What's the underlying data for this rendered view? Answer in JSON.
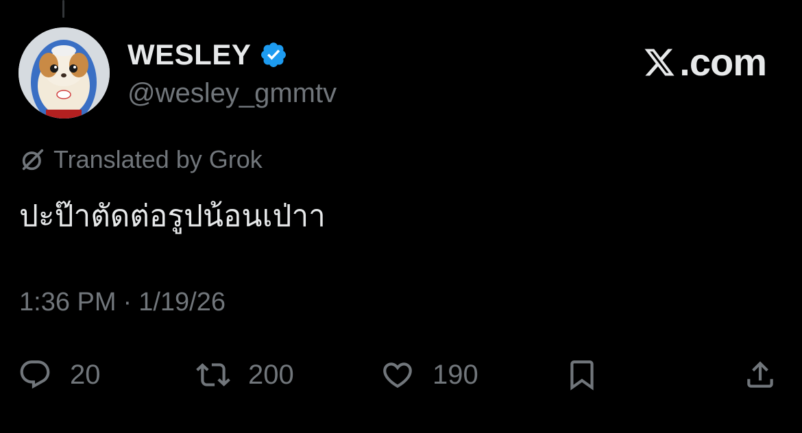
{
  "user": {
    "display_name": "WESLEY",
    "handle": "@wesley_gmmtv",
    "verified_icon": "verified-badge-icon"
  },
  "brand": {
    "text": ".com",
    "logo_icon": "x-logo-icon"
  },
  "tweet": {
    "translation_label": "Translated by Grok",
    "text": "ปะป๊าตัดต่อรูปน้อนเป่าา",
    "time": "1:36 PM",
    "separator": "·",
    "date": "1/19/26"
  },
  "actions": {
    "replies": "20",
    "reposts": "200",
    "likes": "190"
  },
  "colors": {
    "background": "#000000",
    "primary_text": "#e7e9ea",
    "secondary_text": "#71767b",
    "verified_blue": "#1d9bf0"
  }
}
